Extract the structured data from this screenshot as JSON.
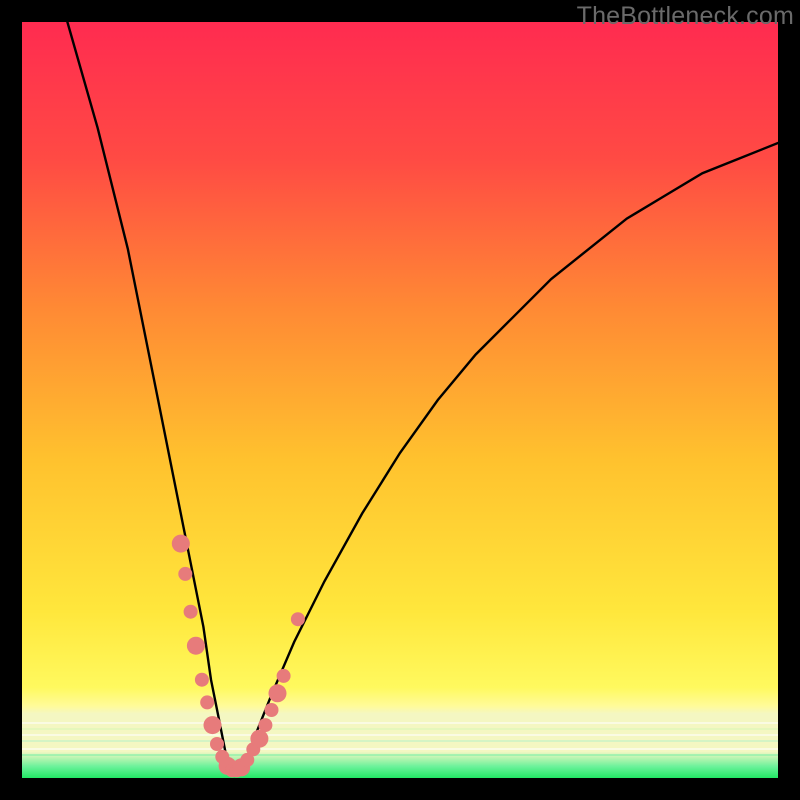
{
  "watermark": "TheBottleneck.com",
  "colors": {
    "bg_black": "#000000",
    "grad_top": "#ff2f4f",
    "grad_mid1": "#ff6a3a",
    "grad_mid2": "#ffb430",
    "grad_mid3": "#ffe03a",
    "grad_band_pale": "#fbf7a8",
    "grad_green": "#2bea6f",
    "grad_white": "#e2ffe2",
    "curve": "#000000",
    "dot_fill": "#e77b7b",
    "dot_stroke": "#c85858"
  },
  "chart_data": {
    "type": "line",
    "title": "",
    "xlabel": "",
    "ylabel": "",
    "xlim": [
      0,
      100
    ],
    "ylim": [
      0,
      100
    ],
    "notes": "V-shaped bottleneck curve. y≈100 means worst (top, red); y≈0 means best (bottom, green). Minimum (bottleneck sweet spot) around x≈28. Left branch falls very steeply from upper-left; right branch rises with diminishing slope toward upper-right. Values are visual estimates from the plot — no axis ticks are shown.",
    "series": [
      {
        "name": "bottleneck-curve",
        "x": [
          6,
          10,
          14,
          18,
          20,
          22,
          24,
          25,
          26,
          27,
          28,
          29,
          30,
          31,
          33,
          36,
          40,
          45,
          50,
          55,
          60,
          65,
          70,
          75,
          80,
          85,
          90,
          95,
          100
        ],
        "y": [
          100,
          86,
          70,
          50,
          40,
          30,
          20,
          13,
          8,
          3,
          1,
          1,
          3,
          6,
          11,
          18,
          26,
          35,
          43,
          50,
          56,
          61,
          66,
          70,
          74,
          77,
          80,
          82,
          84
        ]
      }
    ],
    "points": {
      "name": "sample-dots",
      "comment": "Salmon dots clustered along the lower part of the V near the minimum and a short way up each branch.",
      "x": [
        21.0,
        21.6,
        22.3,
        23.0,
        23.8,
        24.5,
        25.2,
        25.8,
        26.5,
        27.2,
        27.8,
        28.4,
        29.0,
        29.8,
        30.6,
        31.4,
        32.2,
        33.0,
        33.8,
        34.6,
        36.5
      ],
      "y": [
        31.0,
        27.0,
        22.0,
        17.5,
        13.0,
        10.0,
        7.0,
        4.5,
        2.8,
        1.6,
        1.0,
        1.0,
        1.4,
        2.4,
        3.8,
        5.2,
        7.0,
        9.0,
        11.2,
        13.5,
        21.0
      ]
    },
    "gradient_bands": [
      {
        "y_from": 100,
        "y_to": 20,
        "desc": "smooth red→orange→yellow"
      },
      {
        "y_from": 20,
        "y_to": 12,
        "desc": "yellow"
      },
      {
        "y_from": 12,
        "y_to": 6,
        "desc": "pale yellow band"
      },
      {
        "y_from": 6,
        "y_to": 2,
        "desc": "green/white striations"
      },
      {
        "y_from": 2,
        "y_to": 0,
        "desc": "bright green base"
      }
    ]
  }
}
